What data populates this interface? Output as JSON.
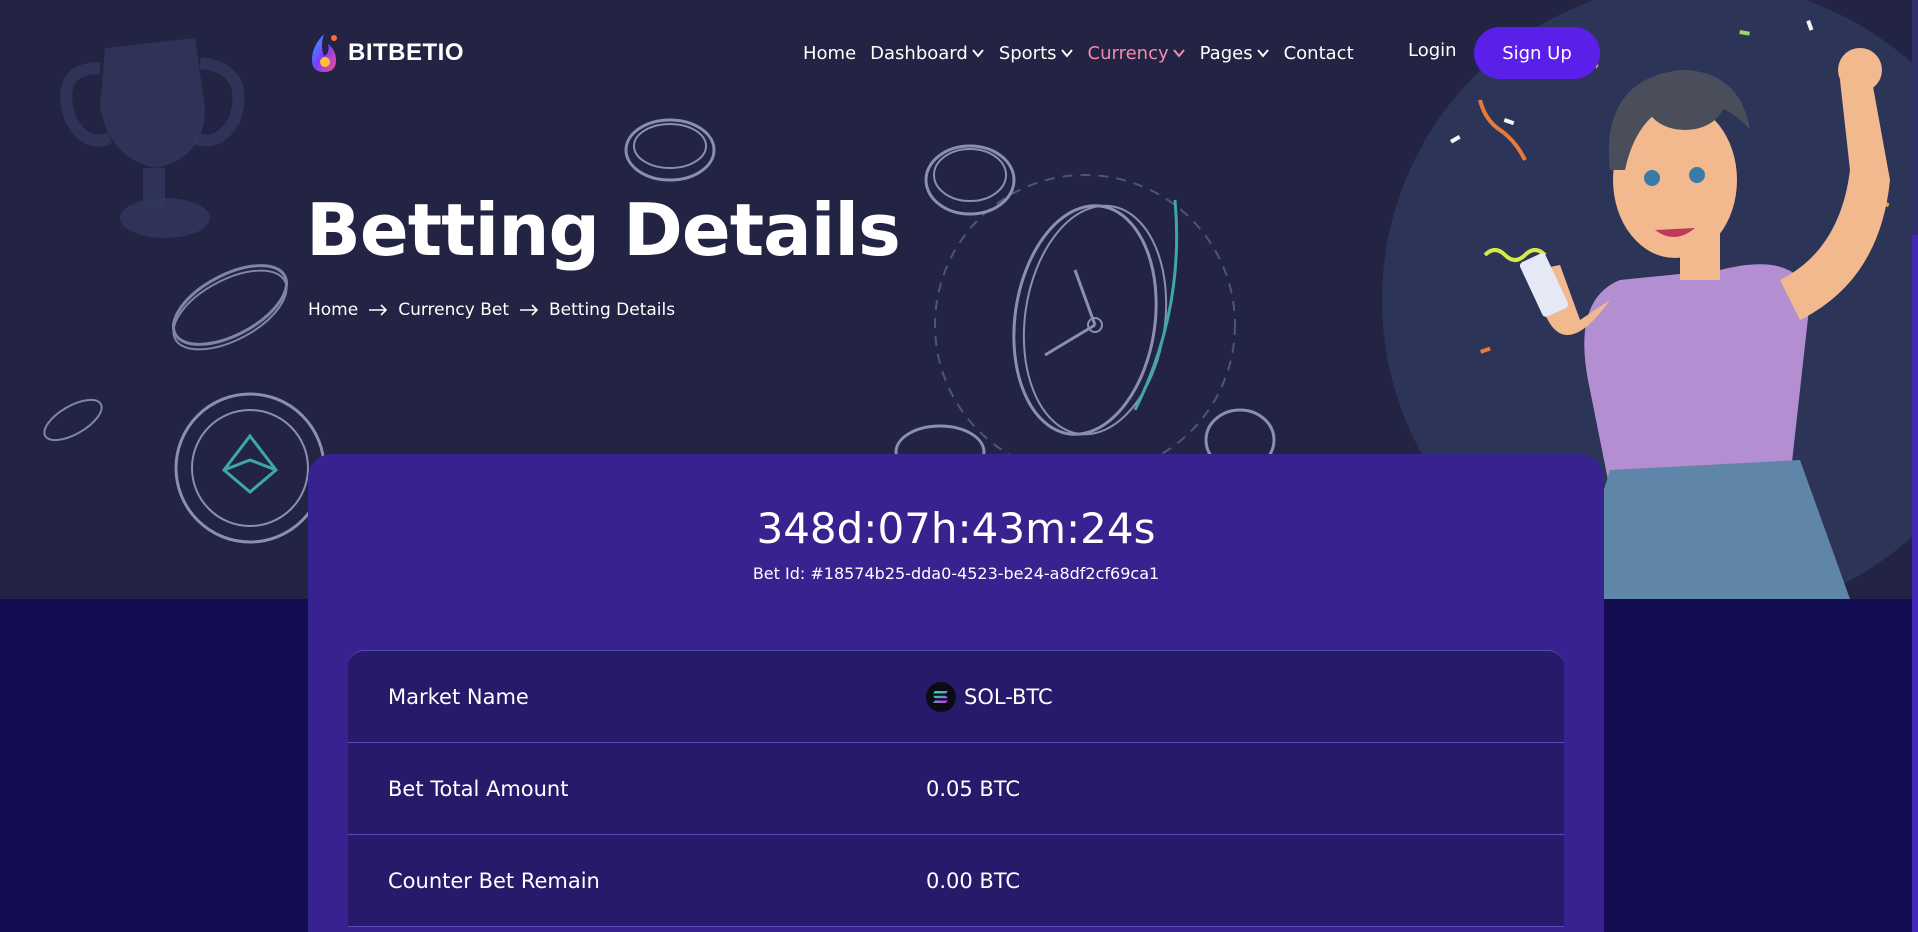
{
  "brand": {
    "name": "BITBETIO"
  },
  "nav": {
    "items": [
      {
        "label": "Home",
        "dropdown": false,
        "active": false
      },
      {
        "label": "Dashboard",
        "dropdown": true,
        "active": false
      },
      {
        "label": "Sports",
        "dropdown": true,
        "active": false
      },
      {
        "label": "Currency",
        "dropdown": true,
        "active": true
      },
      {
        "label": "Pages",
        "dropdown": true,
        "active": false
      },
      {
        "label": "Contact",
        "dropdown": false,
        "active": false
      }
    ],
    "login_label": "Login",
    "signup_label": "Sign Up"
  },
  "hero": {
    "title": "Betting Details",
    "breadcrumb": [
      "Home",
      "Currency Bet",
      "Betting Details"
    ]
  },
  "bet": {
    "countdown": "348d:07h:43m:24s",
    "bet_id": "Bet Id: #18574b25-dda0-4523-be24-a8df2cf69ca1",
    "rows": [
      {
        "label": "Market Name",
        "value": "SOL-BTC",
        "icon": "solana-coin-icon"
      },
      {
        "label": "Bet Total Amount",
        "value": "0.05 BTC"
      },
      {
        "label": "Counter Bet Remain",
        "value": "0.00 BTC"
      }
    ]
  },
  "colors": {
    "hero_bg": "#232343",
    "page_bg": "#140d52",
    "card_bg": "#38228f",
    "table_bg": "#261a6b",
    "accent": "#5a1fe8",
    "active_nav": "#f28cae"
  }
}
